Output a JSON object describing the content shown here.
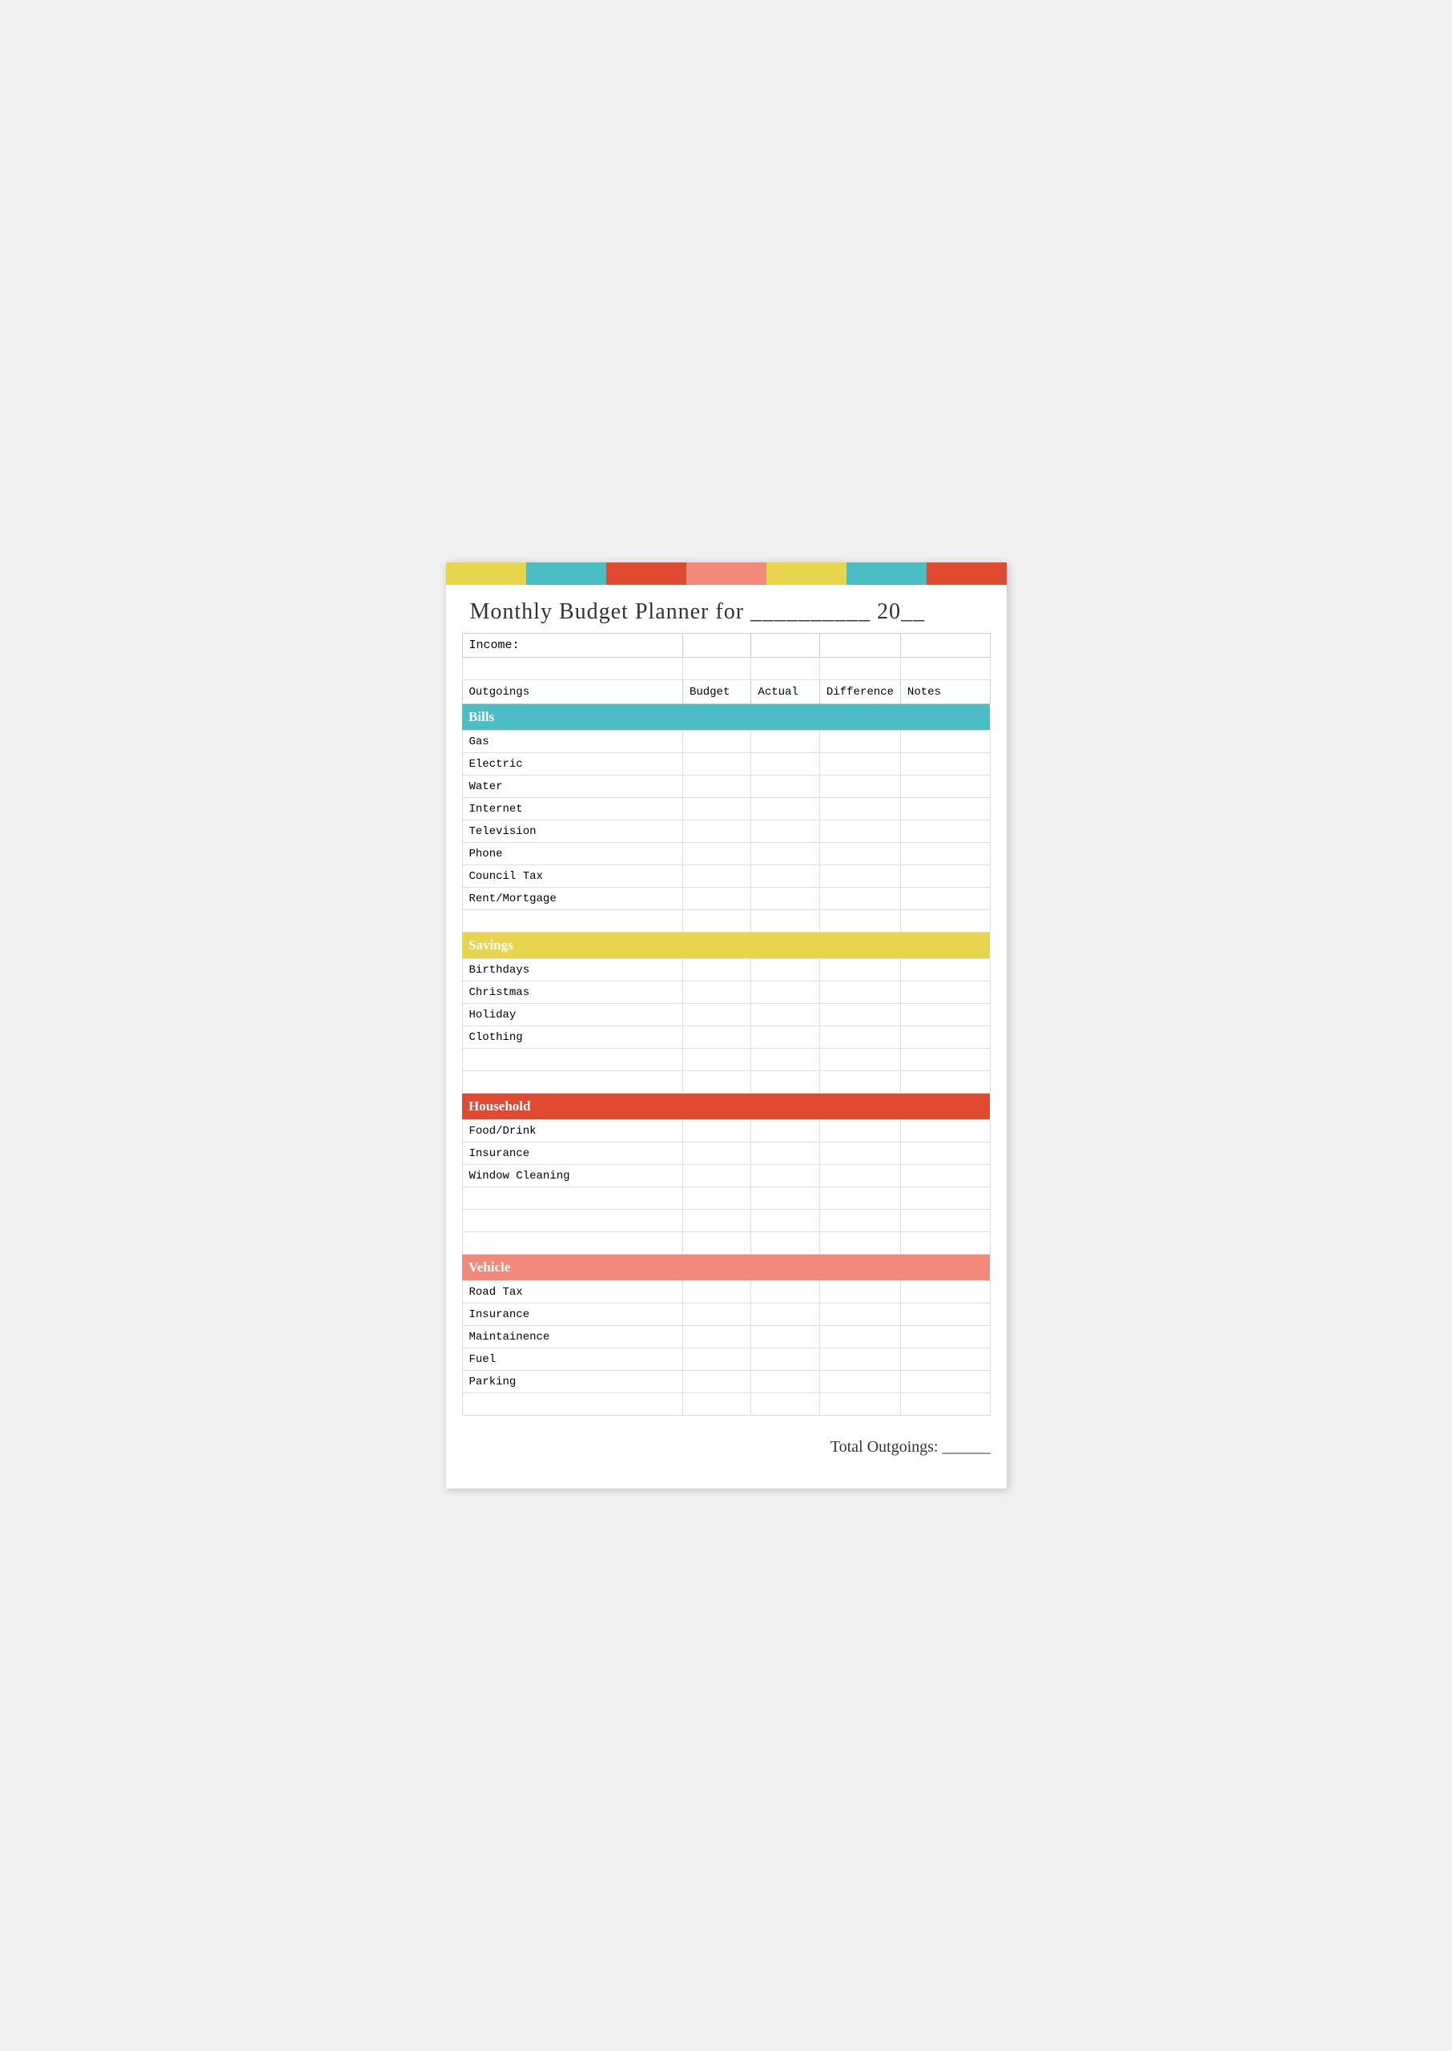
{
  "colorBarsTop": [
    {
      "color": "#e8d44d"
    },
    {
      "color": "#4bbdc4"
    },
    {
      "color": "#e04a30"
    },
    {
      "color": "#f2897a"
    },
    {
      "color": "#e8d44d"
    },
    {
      "color": "#4bbdc4"
    },
    {
      "color": "#e04a30"
    }
  ],
  "colorBarsBottom": [
    {
      "color": "#e8d44d"
    },
    {
      "color": "#4bbdc4"
    },
    {
      "color": "#e04a30"
    },
    {
      "color": "#f2897a"
    },
    {
      "color": "#e8d44d"
    },
    {
      "color": "#4bbdc4"
    },
    {
      "color": "#e04a30"
    }
  ],
  "title": "Monthly Budget Planner for __________ 20__",
  "income_label": "Income:",
  "columns": {
    "outgoings": "Outgoings",
    "budget": "Budget",
    "actual": "Actual",
    "difference": "Difference",
    "notes": "Notes"
  },
  "categories": [
    {
      "name": "Bills",
      "color_class": "bills-header",
      "items": [
        "Gas",
        "Electric",
        "Water",
        "Internet",
        "Television",
        "Phone",
        "Council Tax",
        "Rent/Mortgage",
        ""
      ]
    },
    {
      "name": "Savings",
      "color_class": "savings-header",
      "items": [
        "Birthdays",
        "Christmas",
        "Holiday",
        "Clothing",
        "",
        ""
      ]
    },
    {
      "name": "Household",
      "color_class": "household-header",
      "items": [
        "Food/Drink",
        "Insurance",
        "Window Cleaning",
        "",
        "",
        ""
      ]
    },
    {
      "name": "Vehicle",
      "color_class": "vehicle-header",
      "items": [
        "Road Tax",
        "Insurance",
        "Maintainence",
        "Fuel",
        "Parking",
        ""
      ]
    }
  ],
  "total_label": "Total Outgoings: ______"
}
